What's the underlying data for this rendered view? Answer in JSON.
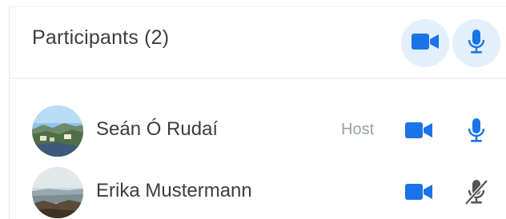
{
  "panel": {
    "title": "Participants (2)",
    "header_actions": [
      {
        "icon": "video-camera-icon"
      },
      {
        "icon": "microphone-icon"
      }
    ]
  },
  "participants": [
    {
      "name": "Seán Ó Rudaí",
      "role": "Host",
      "video_icon": "video-camera-icon",
      "mic_icon": "microphone-icon",
      "mic_muted": false
    },
    {
      "name": "Erika Mustermann",
      "role": "",
      "video_icon": "video-camera-icon",
      "mic_icon": "microphone-muted-icon",
      "mic_muted": true
    }
  ],
  "colors": {
    "accent": "#1a73e8",
    "header_button_bg": "#e3effb",
    "muted_icon": "#555555",
    "text": "#3a3d42",
    "role_text": "#9aa0a6"
  }
}
